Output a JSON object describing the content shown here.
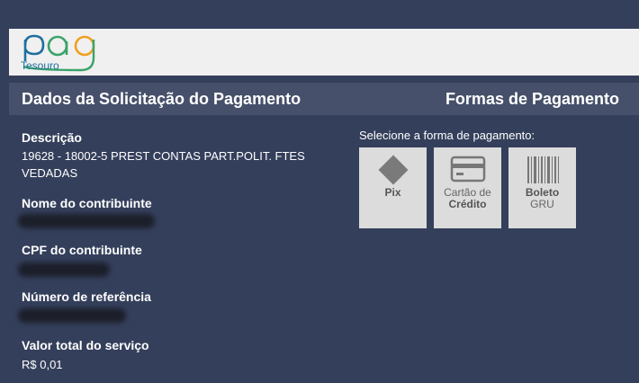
{
  "logo": {
    "brand": "pag",
    "sub": "Tesouro"
  },
  "header": {
    "left_title": "Dados da Solicitação do Pagamento",
    "right_title": "Formas de Pagamento"
  },
  "fields": {
    "descricao_label": "Descrição",
    "descricao_value": "19628 - 18002-5 PREST CONTAS PART.POLIT. FTES VEDADAS",
    "nome_label": "Nome do contribuinte",
    "cpf_label": "CPF do contribuinte",
    "referencia_label": "Número de referência",
    "valor_label": "Valor total do serviço",
    "valor_value": "R$  0,01"
  },
  "payment": {
    "select_label": "Selecione a forma de pagamento:",
    "pix": "Pix",
    "cartao_line1": "Cartão de",
    "cartao_line2": "Crédito",
    "boleto_line1": "Boleto",
    "boleto_line2": "GRU"
  },
  "colors": {
    "background": "#343f5b",
    "header_bar": "#46506a",
    "logo_blue": "#1f6f9f",
    "logo_green": "#3aa36a",
    "logo_orange": "#f0a020"
  }
}
